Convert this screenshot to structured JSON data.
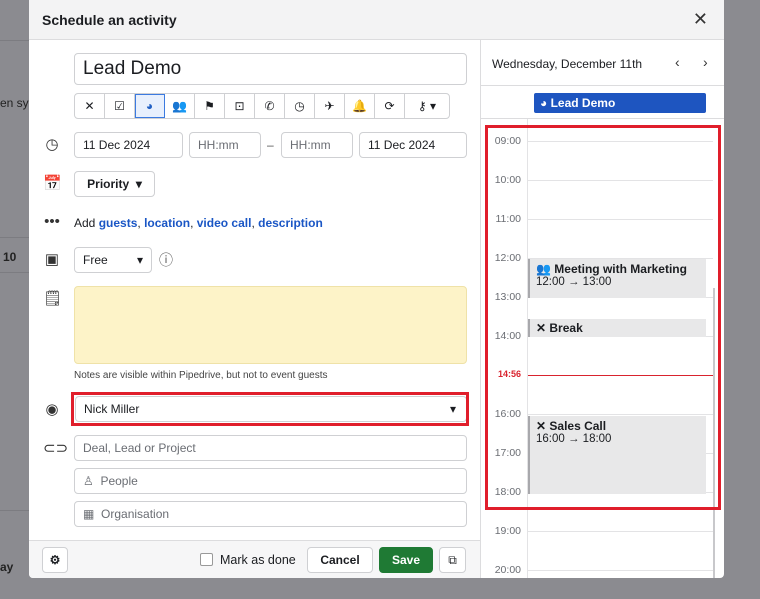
{
  "background": {
    "fragments": [
      "en sy",
      "10",
      "ay"
    ]
  },
  "dialog": {
    "title": "Schedule an activity",
    "close_icon": "close-icon",
    "subject": "Lead Demo",
    "activity_types": [
      {
        "icon": "utensils-icon",
        "glyph": "✕"
      },
      {
        "icon": "checkbox-icon",
        "glyph": "☑"
      },
      {
        "icon": "globe-icon",
        "glyph": "◕",
        "selected": true
      },
      {
        "icon": "people-icon",
        "glyph": "👥"
      },
      {
        "icon": "flag-icon",
        "glyph": "⚑"
      },
      {
        "icon": "inbox-icon",
        "glyph": "⊡"
      },
      {
        "icon": "phone-icon",
        "glyph": "✆"
      },
      {
        "icon": "stopwatch-icon",
        "glyph": "◷"
      },
      {
        "icon": "plane-icon",
        "glyph": "✈"
      },
      {
        "icon": "bell-icon",
        "glyph": "🔔"
      },
      {
        "icon": "repeat-icon",
        "glyph": "⟳"
      },
      {
        "icon": "key-icon",
        "glyph": "⚷ ▾"
      }
    ],
    "start_date": "11 Dec 2024",
    "start_time_placeholder": "HH:mm",
    "dash": "–",
    "end_time_placeholder": "HH:mm",
    "end_date": "11 Dec 2024",
    "priority_label": "Priority",
    "add_prefix": "Add",
    "add_links": [
      "guests",
      "location",
      "video call",
      "description"
    ],
    "availability": "Free",
    "notes_hint": "Notes are visible within Pipedrive, but not to event guests",
    "owner": "Nick Miller",
    "deal_placeholder": "Deal, Lead or Project",
    "people_placeholder": "People",
    "organisation_placeholder": "Organisation",
    "footer": {
      "mark_done": "Mark as done",
      "mark_done_checked": false,
      "cancel": "Cancel",
      "save": "Save"
    },
    "colors": {
      "save": "#1f7a34",
      "link": "#1a56c5",
      "notes_bg": "#fdf3c8",
      "event_chip": "#1e55c0",
      "now_line": "#d9232e",
      "highlight": "#e01e2b"
    }
  },
  "calendar": {
    "date_heading": "Wednesday, December 11th",
    "all_day_event": "Lead Demo",
    "hours": [
      "09:00",
      "10:00",
      "11:00",
      "12:00",
      "13:00",
      "14:00",
      "16:00",
      "17:00",
      "18:00",
      "19:00",
      "20:00"
    ],
    "now": "14:56",
    "events": [
      {
        "title": "Meeting with Marketing",
        "time": "12:00 → 13:00",
        "icon": "people-icon"
      },
      {
        "title": "Break",
        "time": "",
        "icon": "utensils-icon"
      },
      {
        "title": "Sales Call",
        "time": "16:00 → 18:00",
        "icon": "utensils-icon"
      }
    ]
  }
}
